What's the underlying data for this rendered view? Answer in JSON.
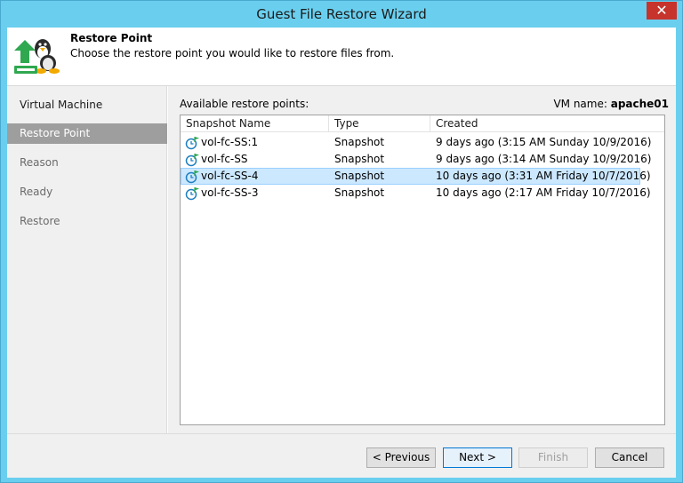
{
  "window": {
    "title": "Guest File Restore Wizard",
    "close_glyph": "✕"
  },
  "header": {
    "title": "Restore Point",
    "description": "Choose the restore point you would like to restore files from.",
    "icon": "linux-restore-icon"
  },
  "steps": [
    {
      "label": "Virtual Machine",
      "state": "done"
    },
    {
      "label": "Restore Point",
      "state": "active"
    },
    {
      "label": "Reason",
      "state": "pending"
    },
    {
      "label": "Ready",
      "state": "pending"
    },
    {
      "label": "Restore",
      "state": "pending"
    }
  ],
  "main": {
    "available_label": "Available restore points:",
    "vm_name_label": "VM name:",
    "vm_name_value": "apache01",
    "columns": [
      "Snapshot Name",
      "Type",
      "Created"
    ],
    "rows": [
      {
        "name": "vol-fc-SS:1",
        "type": "Snapshot",
        "created": "9 days ago (3:15 AM Sunday 10/9/2016)",
        "selected": false
      },
      {
        "name": "vol-fc-SS",
        "type": "Snapshot",
        "created": "9 days ago (3:14 AM Sunday 10/9/2016)",
        "selected": false
      },
      {
        "name": "vol-fc-SS-4",
        "type": "Snapshot",
        "created": "10 days ago (3:31 AM Friday 10/7/2016)",
        "selected": true
      },
      {
        "name": "vol-fc-SS-3",
        "type": "Snapshot",
        "created": "10 days ago (2:17 AM Friday 10/7/2016)",
        "selected": false
      }
    ]
  },
  "footer": {
    "previous": "< Previous",
    "next": "Next >",
    "finish": "Finish",
    "cancel": "Cancel"
  },
  "colors": {
    "title_bar": "#6acfef",
    "close_button": "#c7342b",
    "active_step": "#9e9e9e",
    "selected_row": "#cce8ff",
    "snapshot_flag": "#2fa84f"
  }
}
